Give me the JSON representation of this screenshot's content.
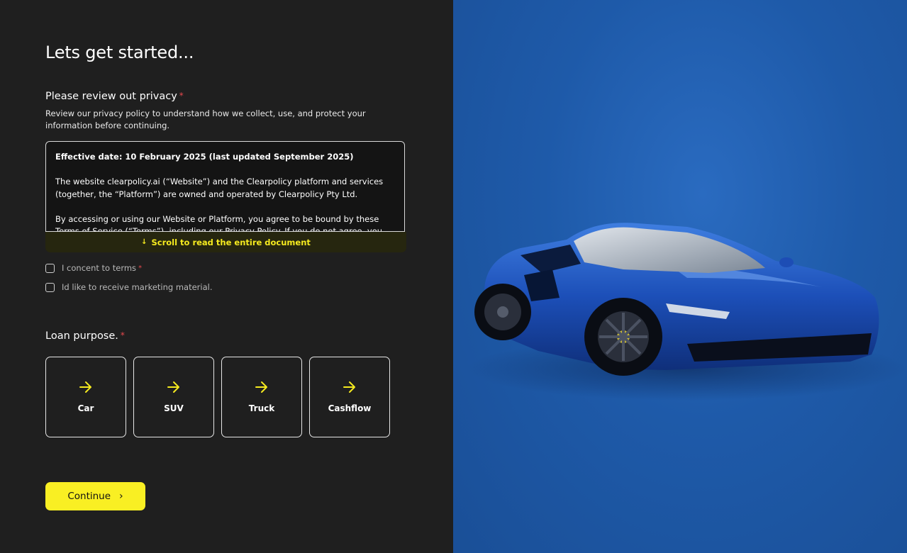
{
  "page": {
    "title": "Lets get started..."
  },
  "privacy": {
    "label": "Please review out privacy",
    "required_mark": "*",
    "description": "Review our privacy policy to understand how we collect, use, and protect your information before continuing.",
    "document": {
      "effective_date": "Effective date: 10 February 2025 (last updated September 2025)",
      "paragraph_1": "The website clearpolicy.ai (“Website”) and the Clearpolicy platform and services (together, the “Platform”) are owned and operated by Clearpolicy Pty Ltd.",
      "paragraph_2": "By accessing or using our Website or Platform, you agree to be bound by these Terms of Service (“Terms”), including our Privacy Policy. If you do not agree, you must"
    },
    "scroll_hint": "Scroll to read the entire document",
    "scroll_hint_icon": "arrow-down-icon"
  },
  "consent": {
    "terms_label": "I concent to terms",
    "terms_required_mark": "*",
    "marketing_label": "Id like to receive marketing material."
  },
  "loan_purpose": {
    "label": "Loan purpose.",
    "required_mark": "*",
    "options": [
      {
        "label": "Car",
        "icon": "arrow-right-icon"
      },
      {
        "label": "SUV",
        "icon": "arrow-right-icon"
      },
      {
        "label": "Truck",
        "icon": "arrow-right-icon"
      },
      {
        "label": "Cashflow",
        "icon": "arrow-right-icon"
      }
    ]
  },
  "actions": {
    "continue_label": "Continue",
    "continue_icon": "chevron-right-icon"
  },
  "colors": {
    "background": "#1f1f1f",
    "accent_yellow": "#f9ef23",
    "required_red": "#e5484d",
    "hero_blue": "#1e5aa9"
  },
  "hero": {
    "image": "blue sports car"
  }
}
